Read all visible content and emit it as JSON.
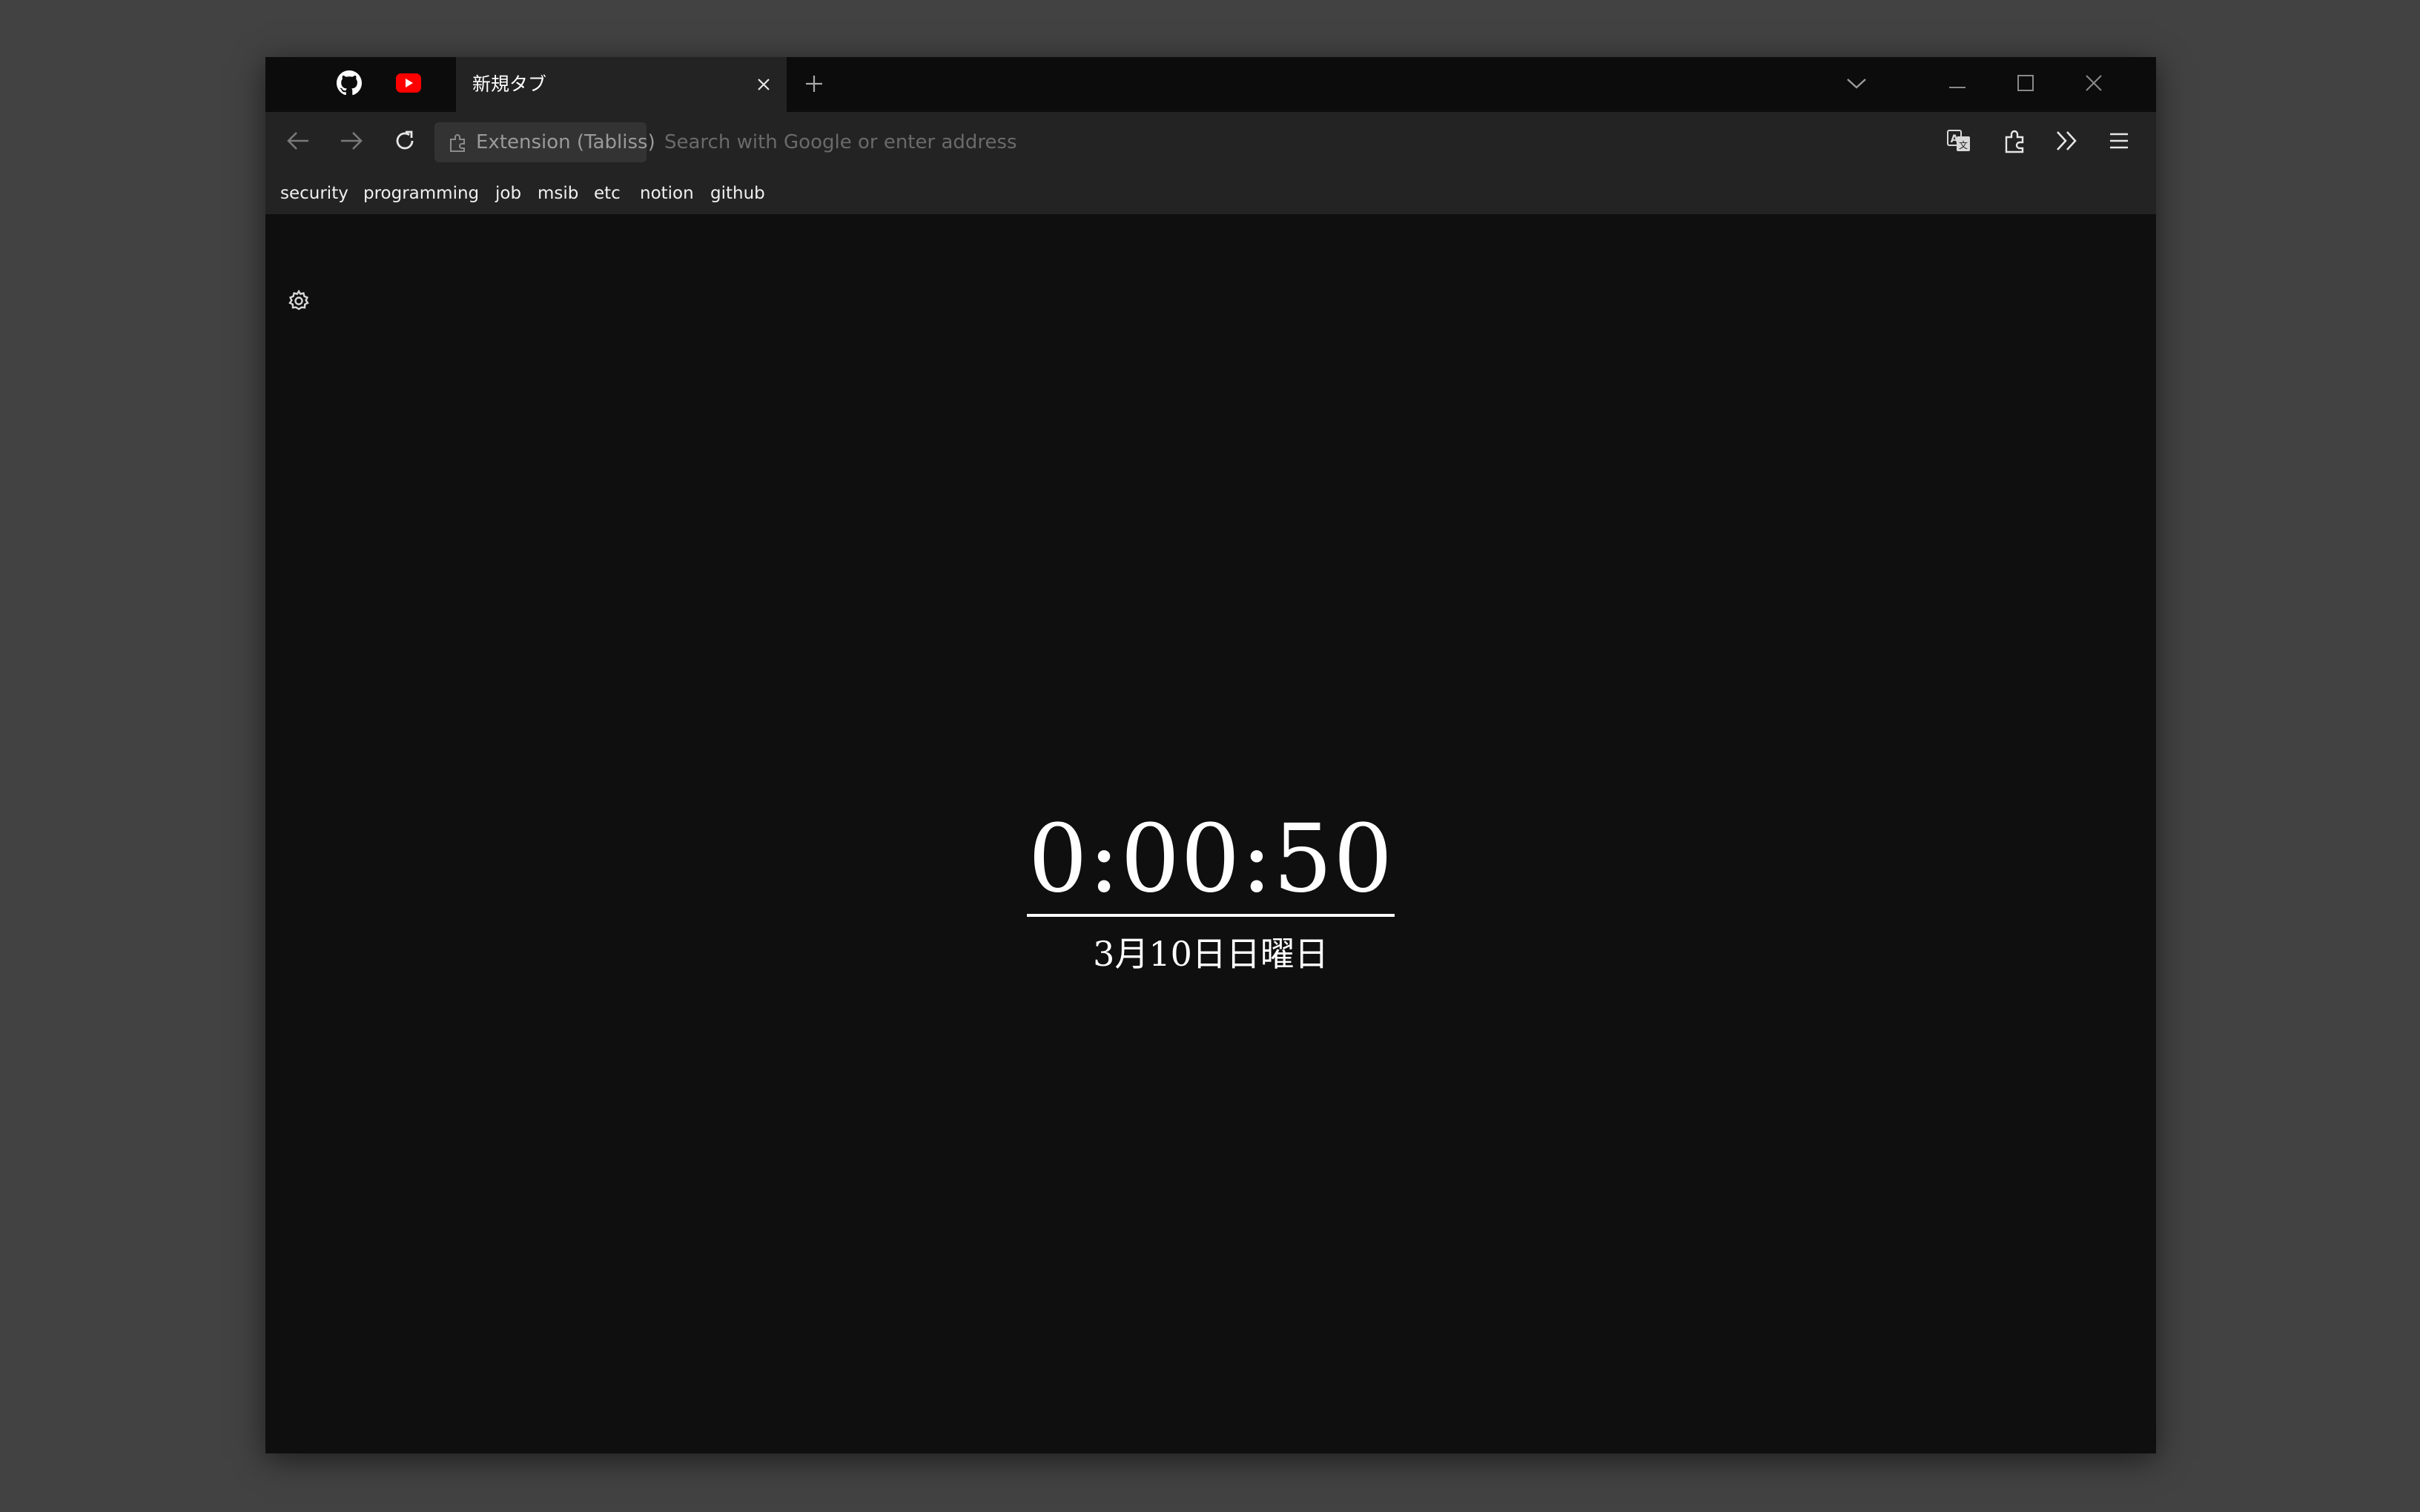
{
  "tabs": {
    "pinned": [
      {
        "icon": "github-icon"
      },
      {
        "icon": "youtube-icon"
      }
    ],
    "active": {
      "title": "新規タブ",
      "close_icon": "close-icon"
    },
    "new_tab_icon": "plus-icon",
    "list_icon": "chevron-down-icon"
  },
  "window_controls": {
    "minimize_icon": "minimize-icon",
    "maximize_icon": "maximize-icon",
    "close_icon": "close-icon"
  },
  "navbar": {
    "back_icon": "back-arrow-icon",
    "forward_icon": "forward-arrow-icon",
    "reload_icon": "reload-icon",
    "identity_label": "Extension (Tabliss)",
    "identity_icon": "puzzle-piece-icon",
    "url_value": "",
    "url_placeholder": "Search with Google or enter address",
    "tools": [
      {
        "icon": "translate-icon"
      },
      {
        "icon": "extensions-icon"
      },
      {
        "icon": "overflow-chevrons-icon"
      },
      {
        "icon": "hamburger-menu-icon"
      }
    ]
  },
  "bookmarks": [
    "security",
    "programming",
    "job",
    "msib",
    "etc",
    "notion",
    "github"
  ],
  "content": {
    "settings_icon": "gear-icon",
    "clock": "0:00:50",
    "date": "3月10日日曜日"
  },
  "colors": {
    "desktop": "#424242",
    "tabstrip": "#0c0c0c",
    "toolbar": "#232323",
    "content": "#0f0f0f",
    "youtube_red": "#ff0000",
    "text": "#ffffff"
  }
}
